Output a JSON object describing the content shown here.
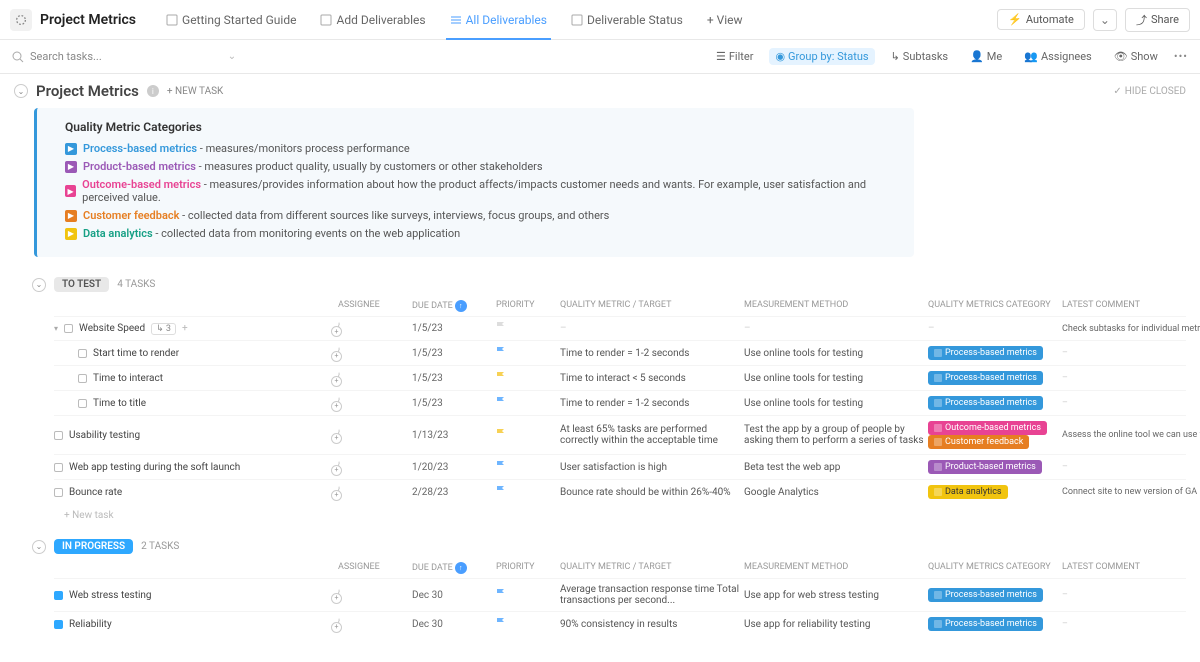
{
  "header": {
    "title": "Project Metrics",
    "tabs": [
      {
        "label": "Getting Started Guide"
      },
      {
        "label": "Add Deliverables"
      },
      {
        "label": "All Deliverables"
      },
      {
        "label": "Deliverable Status"
      },
      {
        "label": "+ View"
      }
    ],
    "automate": "Automate",
    "share": "Share"
  },
  "toolbar": {
    "search_placeholder": "Search tasks...",
    "filter": "Filter",
    "group_by": "Group by: Status",
    "subtasks": "Subtasks",
    "me": "Me",
    "assignees": "Assignees",
    "show": "Show"
  },
  "list_header": {
    "title": "Project Metrics",
    "new_task": "+ NEW TASK",
    "hide_closed": "HIDE CLOSED"
  },
  "desc": {
    "title": "Quality Metric Categories",
    "rows": [
      {
        "link": "Process-based metrics",
        "text": " - measures/monitors process performance",
        "cls": ""
      },
      {
        "link": "Product-based metrics",
        "text": " - measures product quality, usually by  customers or other stakeholders",
        "cls": "purple"
      },
      {
        "link": "Outcome-based metrics",
        "text": " - measures/provides information about how the product affects/impacts customer needs and wants. For example, user satisfaction and perceived value.",
        "cls": "pink"
      },
      {
        "link": "Customer feedback",
        "text": " - collected data from different sources like surveys, interviews, focus groups, and others",
        "cls": "orange"
      },
      {
        "link": "Data analytics",
        "text": " - collected data from monitoring events on the web application",
        "cls": "teal"
      }
    ]
  },
  "columns": {
    "assignee": "ASSIGNEE",
    "due_date": "DUE DATE",
    "priority": "PRIORITY",
    "metric_target": "QUALITY METRIC / TARGET",
    "measurement": "MEASUREMENT METHOD",
    "category": "QUALITY METRICS CATEGORY",
    "comment": "LATEST COMMENT"
  },
  "groups": [
    {
      "name": "TO TEST",
      "count": "4 TASKS",
      "pill_cls": "",
      "tasks": [
        {
          "name": "Website Speed",
          "indent": false,
          "subtasks": "3",
          "due": "1/5/23",
          "flag": "grey",
          "metric": "–",
          "method": "–",
          "badges": [],
          "comment": "Check subtasks for individual metrics",
          "caret": true
        },
        {
          "name": "Start time to render",
          "indent": true,
          "due": "1/5/23",
          "flag": "blue",
          "metric": "Time to render = 1-2 seconds",
          "method": "Use online tools for testing",
          "badges": [
            "process"
          ],
          "comment": "–"
        },
        {
          "name": "Time to interact",
          "indent": true,
          "due": "1/5/23",
          "flag": "yellow",
          "metric": "Time to interact < 5 seconds",
          "method": "Use online tools for testing",
          "badges": [
            "process"
          ],
          "comment": "–"
        },
        {
          "name": "Time to title",
          "indent": true,
          "due": "1/5/23",
          "flag": "blue",
          "metric": "Time to render = 1-2 seconds",
          "method": "Use online tools for testing",
          "badges": [
            "process"
          ],
          "comment": "–"
        },
        {
          "name": "Usability testing",
          "indent": false,
          "due": "1/13/23",
          "flag": "yellow",
          "metric": "At least 65% tasks are performed correctly within the acceptable time",
          "method": "Test the app by a group of people by asking them to perform a series of tasks",
          "badges": [
            "outcome",
            "feedback"
          ],
          "comment": "Assess the online tool we can use for this"
        },
        {
          "name": "Web app testing during the soft launch",
          "indent": false,
          "due": "1/20/23",
          "flag": "blue",
          "metric": "User satisfaction is high",
          "method": "Beta test the web app",
          "badges": [
            "product"
          ],
          "comment": "–"
        },
        {
          "name": "Bounce rate",
          "indent": false,
          "due": "2/28/23",
          "flag": "blue",
          "metric": "Bounce rate should be within 26%-40%",
          "method": "Google Analytics",
          "badges": [
            "analytics"
          ],
          "comment": "Connect site to new version of GA"
        }
      ],
      "new_task": "+ New task"
    },
    {
      "name": "IN PROGRESS",
      "count": "2 TASKS",
      "pill_cls": "progress",
      "tasks": [
        {
          "name": "Web stress testing",
          "indent": false,
          "due": "Dec 30",
          "flag": "blue",
          "metric": "Average transaction response time Total transactions per second...",
          "method": "Use app for web stress testing",
          "badges": [
            "process"
          ],
          "comment": "–",
          "filled": true
        },
        {
          "name": "Reliability",
          "indent": false,
          "due": "Dec 30",
          "flag": "blue",
          "metric": "90% consistency in results",
          "method": "Use app for reliability testing",
          "badges": [
            "process"
          ],
          "comment": "–",
          "filled": true
        }
      ]
    }
  ],
  "badge_labels": {
    "process": "Process-based metrics",
    "outcome": "Outcome-based metrics",
    "feedback": "Customer feedback",
    "product": "Product-based metrics",
    "analytics": "Data analytics"
  }
}
